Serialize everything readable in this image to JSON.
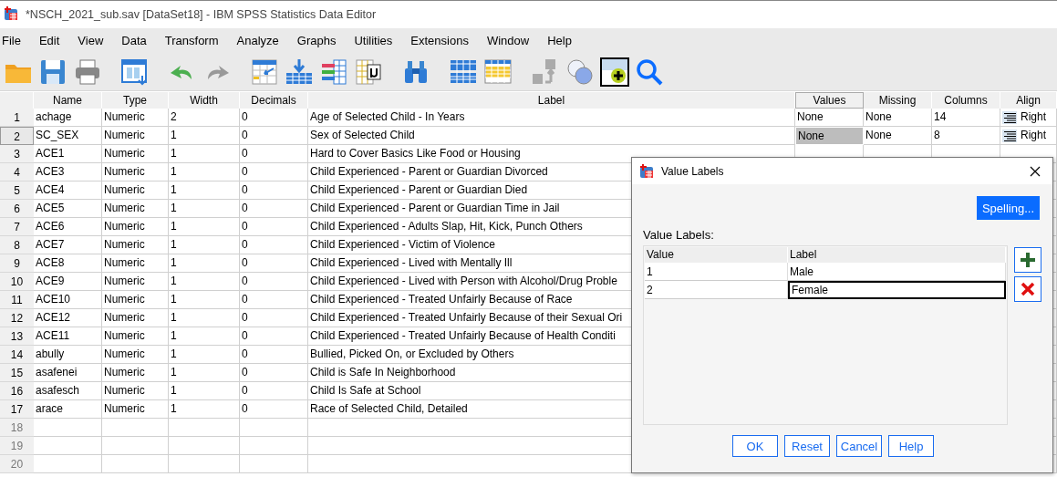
{
  "window": {
    "title": "*NSCH_2021_sub.sav [DataSet18] - IBM SPSS Statistics Data Editor"
  },
  "menu": [
    "File",
    "Edit",
    "View",
    "Data",
    "Transform",
    "Analyze",
    "Graphs",
    "Utilities",
    "Extensions",
    "Window",
    "Help"
  ],
  "grid": {
    "columns": [
      "Name",
      "Type",
      "Width",
      "Decimals",
      "Label",
      "Values",
      "Missing",
      "Columns",
      "Align"
    ],
    "rows": [
      {
        "number": "1",
        "selected": false,
        "values_selected": false,
        "cells": [
          "achage",
          "Numeric",
          "2",
          "0",
          "Age of Selected Child - In Years",
          "None",
          "None",
          "14",
          "Right"
        ]
      },
      {
        "number": "2",
        "selected": true,
        "values_selected": true,
        "cells": [
          "SC_SEX",
          "Numeric",
          "1",
          "0",
          "Sex of Selected Child",
          "None",
          "None",
          "8",
          "Right"
        ]
      },
      {
        "number": "3",
        "selected": false,
        "cells": [
          "ACE1",
          "Numeric",
          "1",
          "0",
          "Hard to Cover Basics Like Food or Housing"
        ]
      },
      {
        "number": "4",
        "selected": false,
        "cells": [
          "ACE3",
          "Numeric",
          "1",
          "0",
          "Child Experienced - Parent or Guardian Divorced"
        ]
      },
      {
        "number": "5",
        "selected": false,
        "cells": [
          "ACE4",
          "Numeric",
          "1",
          "0",
          "Child Experienced - Parent or Guardian Died"
        ]
      },
      {
        "number": "6",
        "selected": false,
        "cells": [
          "ACE5",
          "Numeric",
          "1",
          "0",
          "Child Experienced - Parent or Guardian Time in Jail"
        ]
      },
      {
        "number": "7",
        "selected": false,
        "cells": [
          "ACE6",
          "Numeric",
          "1",
          "0",
          "Child Experienced - Adults Slap, Hit, Kick, Punch Others"
        ]
      },
      {
        "number": "8",
        "selected": false,
        "cells": [
          "ACE7",
          "Numeric",
          "1",
          "0",
          "Child Experienced - Victim of Violence"
        ]
      },
      {
        "number": "9",
        "selected": false,
        "cells": [
          "ACE8",
          "Numeric",
          "1",
          "0",
          "Child Experienced - Lived with Mentally Ill"
        ]
      },
      {
        "number": "10",
        "selected": false,
        "cells": [
          "ACE9",
          "Numeric",
          "1",
          "0",
          "Child Experienced - Lived with Person with Alcohol/Drug Proble"
        ]
      },
      {
        "number": "11",
        "selected": false,
        "cells": [
          "ACE10",
          "Numeric",
          "1",
          "0",
          "Child Experienced - Treated Unfairly Because of Race"
        ]
      },
      {
        "number": "12",
        "selected": false,
        "cells": [
          "ACE12",
          "Numeric",
          "1",
          "0",
          "Child Experienced - Treated Unfairly Because of their Sexual Ori"
        ]
      },
      {
        "number": "13",
        "selected": false,
        "cells": [
          "ACE11",
          "Numeric",
          "1",
          "0",
          "Child Experienced - Treated Unfairly Because of Health Conditi"
        ]
      },
      {
        "number": "14",
        "selected": false,
        "cells": [
          "abully",
          "Numeric",
          "1",
          "0",
          "Bullied, Picked On, or Excluded by Others"
        ]
      },
      {
        "number": "15",
        "selected": false,
        "cells": [
          "asafenei",
          "Numeric",
          "1",
          "0",
          "Child is Safe In Neighborhood"
        ]
      },
      {
        "number": "16",
        "selected": false,
        "cells": [
          "asafesch",
          "Numeric",
          "1",
          "0",
          "Child Is Safe at School"
        ]
      },
      {
        "number": "17",
        "selected": false,
        "cells": [
          "arace",
          "Numeric",
          "1",
          "0",
          "Race of Selected Child, Detailed"
        ]
      },
      {
        "number": "18",
        "selected": false,
        "cells": []
      },
      {
        "number": "19",
        "selected": false,
        "cells": []
      },
      {
        "number": "20",
        "selected": false,
        "cells": []
      }
    ]
  },
  "dialog": {
    "title": "Value Labels",
    "spelling_button": "Spelling...",
    "section_label": "Value Labels:",
    "columns": [
      "Value",
      "Label"
    ],
    "rows": [
      {
        "value": "1",
        "label": "Male",
        "selected": false
      },
      {
        "value": "2",
        "label": "Female",
        "selected": true
      }
    ],
    "buttons": [
      "OK",
      "Reset",
      "Cancel",
      "Help"
    ]
  }
}
